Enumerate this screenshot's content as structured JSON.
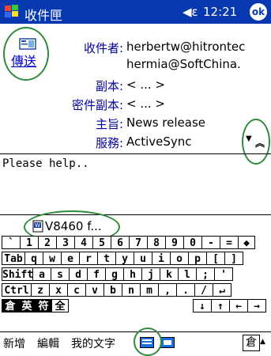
{
  "titlebar": {
    "title": "收件匣",
    "time": "12:21",
    "ok": "ok",
    "speaker": "◀€"
  },
  "header": {
    "send_label": "傳送",
    "fields": [
      {
        "label": "收件者:",
        "value": "herbertw@hitrontec"
      },
      {
        "label": "",
        "value": "hermia@SoftChina."
      },
      {
        "label": "副本:",
        "value": "< ... >"
      },
      {
        "label": "密件副本:",
        "value": "< ... >"
      },
      {
        "label": "主旨:",
        "value": "News release"
      },
      {
        "label": "服務:",
        "value": "ActiveSync"
      }
    ]
  },
  "message": {
    "body": "Please help.."
  },
  "attachment": {
    "name": "V8460 f..."
  },
  "keyboard": {
    "row1": [
      "`",
      "1",
      "2",
      "3",
      "4",
      "5",
      "6",
      "7",
      "8",
      "9",
      "0",
      "-",
      "=",
      "◆"
    ],
    "row2": [
      "Tab",
      "q",
      "w",
      "e",
      "r",
      "t",
      "y",
      "u",
      "i",
      "o",
      "p",
      "[",
      "]"
    ],
    "row3": [
      "Shift",
      "a",
      "s",
      "d",
      "f",
      "g",
      "h",
      "j",
      "k",
      "l",
      ";",
      "'"
    ],
    "row4": [
      "Ctrl",
      "z",
      "x",
      "c",
      "v",
      "b",
      "n",
      "m",
      ",",
      ".",
      "/",
      "↵"
    ],
    "row5": [
      "倉",
      "英",
      "符",
      "全",
      "↓",
      "↑",
      "←",
      "→"
    ]
  },
  "bottombar": {
    "menu": [
      "新增",
      "編輯",
      "我的文字"
    ],
    "ime_button": "倉",
    "ime_arrow": "▲"
  },
  "colors": {
    "titlebar": "#0838b0",
    "link": "#0000c8",
    "annotation": "#2e8b3a"
  }
}
